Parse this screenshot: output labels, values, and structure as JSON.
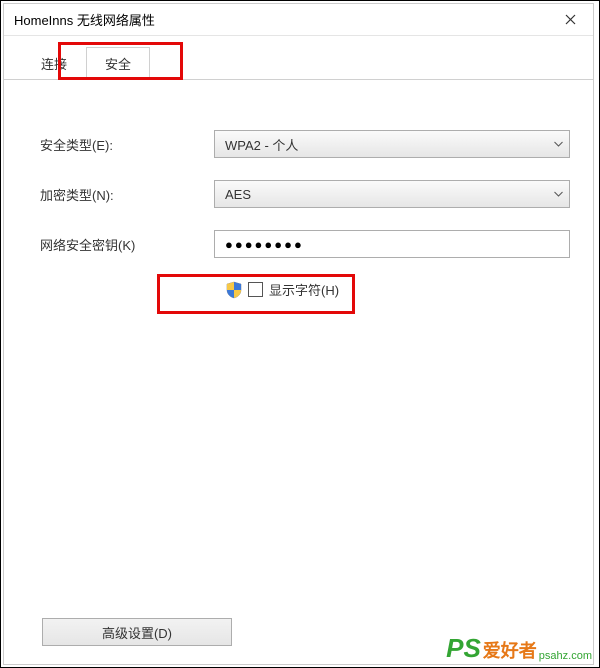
{
  "titlebar": {
    "title": "HomeInns 无线网络属性"
  },
  "tabs": {
    "connection": "连接",
    "security": "安全"
  },
  "form": {
    "securityType": {
      "label": "安全类型(E):",
      "value": "WPA2 - 个人"
    },
    "encryptionType": {
      "label": "加密类型(N):",
      "value": "AES"
    },
    "networkKey": {
      "label": "网络安全密钥(K)",
      "value": "●●●●●●●●"
    },
    "showChars": {
      "label": "显示字符(H)"
    }
  },
  "buttons": {
    "advanced": "高级设置(D)"
  },
  "watermark": {
    "ps": "PS",
    "t1": "爱好者",
    "t2": "psahz.com"
  }
}
